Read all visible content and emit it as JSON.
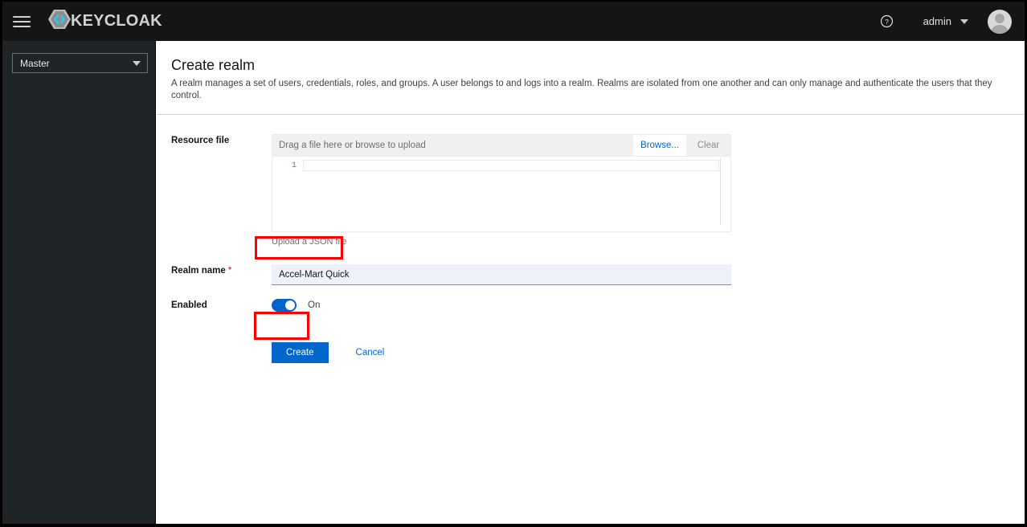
{
  "masthead": {
    "menu_toggle_name": "Global navigation",
    "brand_text": "KEYCLOAK",
    "help_icon": "help-circle-icon",
    "username": "admin",
    "avatar_icon": "user-avatar-icon"
  },
  "sidebar": {
    "realm_selector": {
      "selected": "Master",
      "caret_icon": "chevron-down-icon"
    }
  },
  "page": {
    "title": "Create realm",
    "subtitle": "A realm manages a set of users, credentials, roles, and groups. A user belongs to and logs into a realm. Realms are isolated from one another and can only manage and authenticate the users that they control."
  },
  "form": {
    "resource_file": {
      "label": "Resource file",
      "drop_placeholder": "Drag a file here or browse to upload",
      "browse_label": "Browse...",
      "clear_label": "Clear",
      "editor_line_number": "1",
      "editor_value": "",
      "helper_text": "Upload a JSON file"
    },
    "realm_name": {
      "label": "Realm name",
      "required_marker": "*",
      "value": "Accel-Mart Quick"
    },
    "enabled": {
      "label": "Enabled",
      "state_label": "On",
      "checked": "true"
    },
    "actions": {
      "create_label": "Create",
      "cancel_label": "Cancel"
    }
  },
  "colors": {
    "masthead_bg": "#151515",
    "sidebar_bg": "#212427",
    "accent_blue": "#0066cc",
    "required_red": "#c9190b",
    "annotation_red": "#ff0000",
    "brand_cyan": "#33c6e8"
  }
}
